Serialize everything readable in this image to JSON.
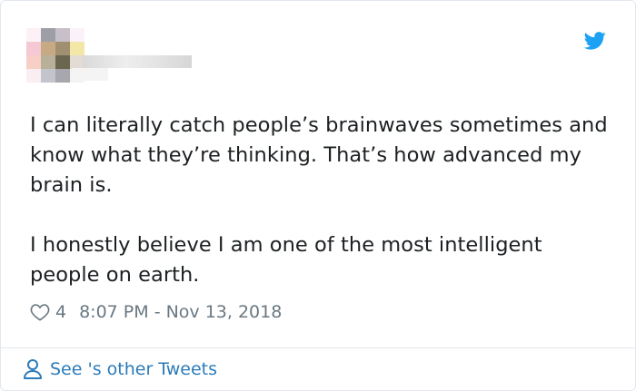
{
  "tweet": {
    "paragraphs": [
      "I can literally catch people’s brainwaves sometimes and know what they’re thinking. That’s how advanced my brain is.",
      "I honestly believe I am one of the most intelligent people on earth."
    ],
    "likes": "4",
    "timestamp": "8:07 PM - Nov 13, 2018"
  },
  "footer": {
    "link_label": "See 's other Tweets"
  },
  "icons": {
    "brand": "twitter-bird-icon",
    "like": "heart-icon",
    "profile": "person-icon"
  },
  "colors": {
    "brand_blue": "#1da1f2",
    "link_blue": "#2b7bb9",
    "meta_gray": "#697882",
    "text": "#1c2022"
  }
}
